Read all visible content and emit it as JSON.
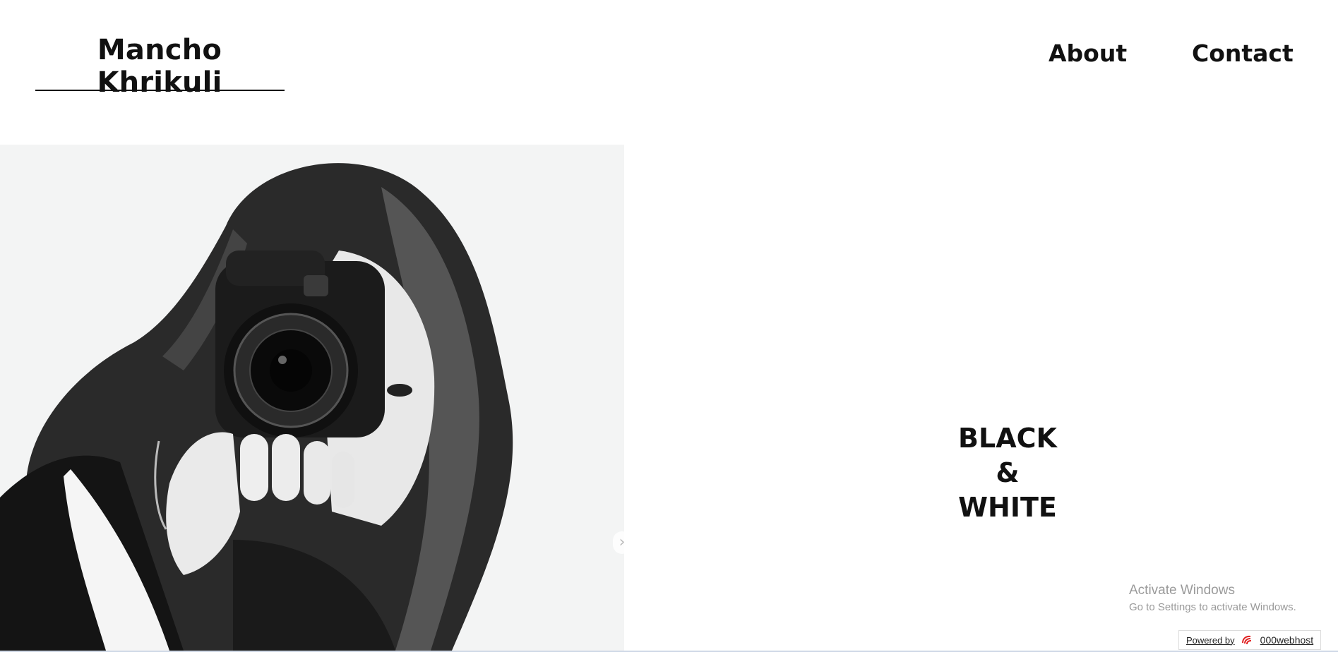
{
  "header": {
    "brand": "Mancho Khrikuli",
    "nav": [
      "About",
      "Contact"
    ]
  },
  "hero": {
    "photo_icon": "portrait-photo",
    "next_icon": "chevron-right-icon",
    "next_glyph": "›",
    "tagline": [
      "BLACK",
      "&",
      "WHITE"
    ]
  },
  "watermark": {
    "title": "Activate Windows",
    "subtitle": "Go to Settings to activate Windows."
  },
  "badge": {
    "label": "Powered by",
    "brand": "000webhost"
  },
  "colors": {
    "text": "#111111",
    "background": "#ffffff",
    "watermark": "#9a9a9a",
    "badge_accent": "#e02020"
  }
}
